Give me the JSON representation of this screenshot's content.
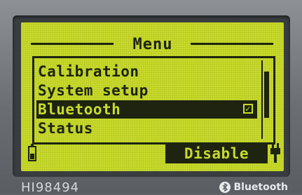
{
  "screen": {
    "title": "Menu",
    "menu_items": [
      {
        "label": "Calibration",
        "selected": false
      },
      {
        "label": "System setup",
        "selected": false
      },
      {
        "label": "Bluetooth",
        "selected": true,
        "checked": true
      },
      {
        "label": "Status",
        "selected": false
      }
    ],
    "softkey_label": "Disable",
    "checkbox_glyph": "☑"
  },
  "device": {
    "model": "HI98494",
    "brand": "Bluetooth"
  },
  "colors": {
    "lcd_background": "#c9db2a",
    "lcd_foreground": "#1e2410"
  },
  "icons": [
    "battery-icon",
    "plug-icon",
    "bluetooth-logo-icon"
  ]
}
